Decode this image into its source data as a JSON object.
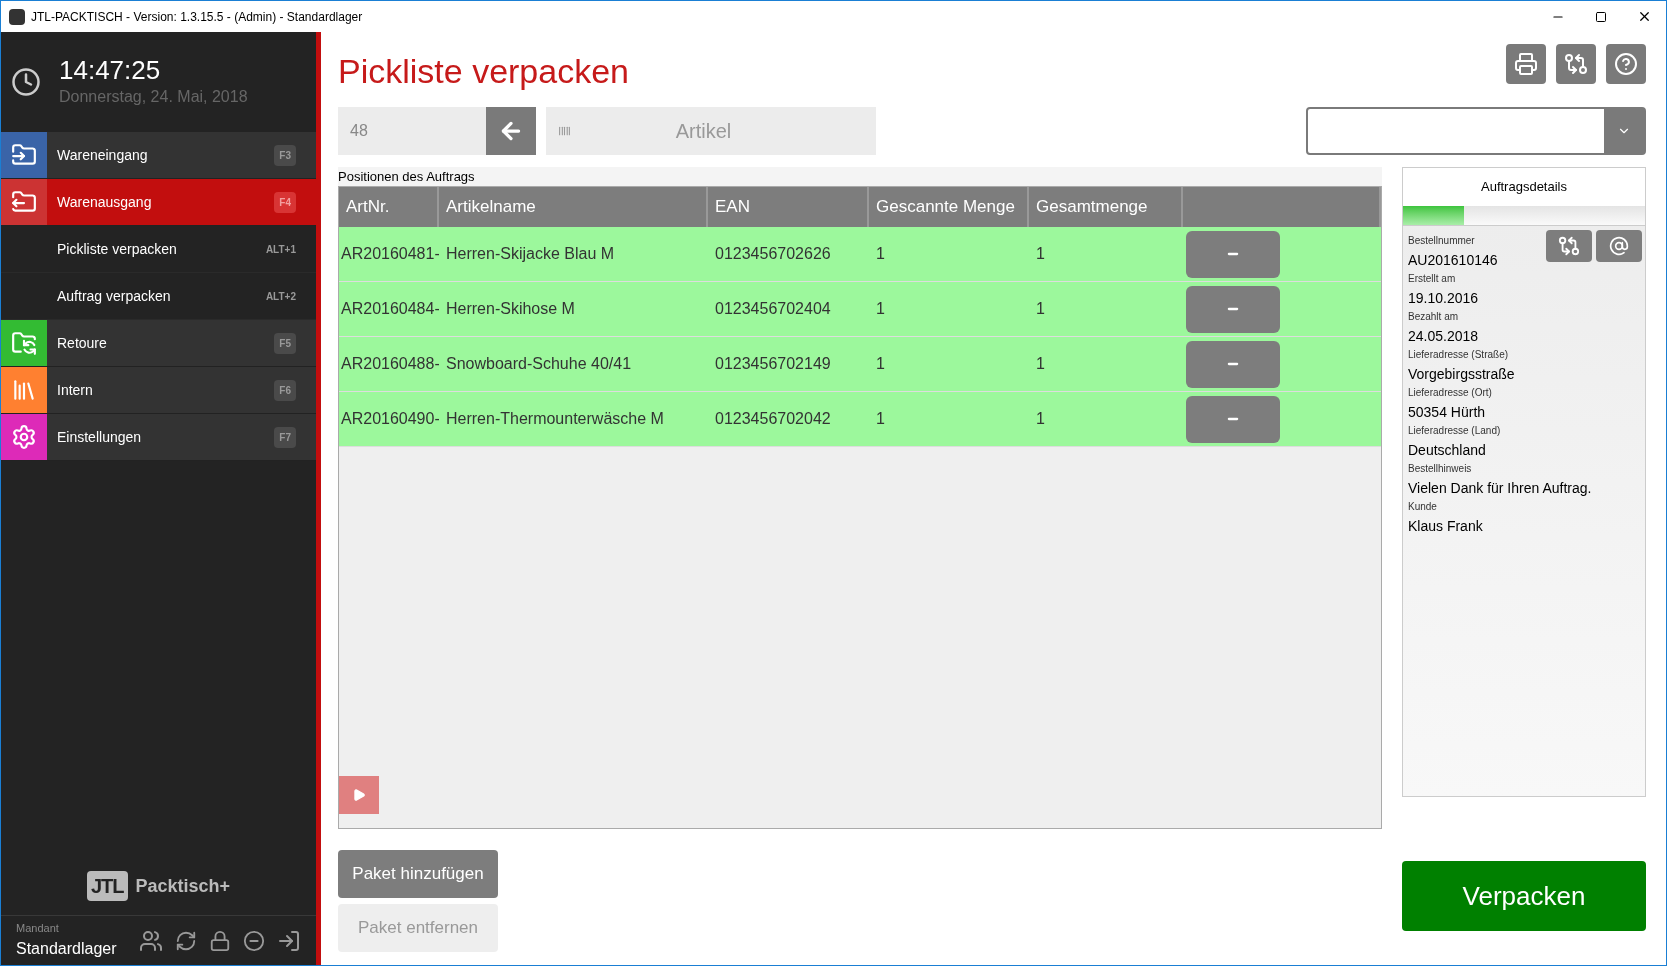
{
  "window": {
    "title": "JTL-PACKTISCH - Version: 1.3.15.5 - (Admin) - Standardlager"
  },
  "clock": {
    "time": "14:47:25",
    "date": "Donnerstag, 24. Mai, 2018"
  },
  "nav": [
    {
      "kind": "section",
      "label": "Wareneingang",
      "shortcut": "F3",
      "color": "#3a64a8",
      "selected": false
    },
    {
      "kind": "section",
      "label": "Warenausgang",
      "shortcut": "F4",
      "color": "#cc3333",
      "selected": true
    },
    {
      "kind": "sub",
      "label": "Pickliste verpacken",
      "shortcut": "ALT+1",
      "selected": false
    },
    {
      "kind": "sub",
      "label": "Auftrag verpacken",
      "shortcut": "ALT+2",
      "selected": false
    },
    {
      "kind": "section",
      "label": "Retoure",
      "shortcut": "F5",
      "color": "#33bb33",
      "selected": false
    },
    {
      "kind": "section",
      "label": "Intern",
      "shortcut": "F6",
      "color": "#ff8030",
      "selected": false
    },
    {
      "kind": "section",
      "label": "Einstellungen",
      "shortcut": "F7",
      "color": "#dd2ab8",
      "selected": false
    }
  ],
  "logo": {
    "mark": "JTL",
    "name": "Packtisch+"
  },
  "mandant": {
    "label": "Mandant",
    "value": "Standardlager"
  },
  "page_title": "Pickliste verpacken",
  "scan": {
    "value": "48",
    "placeholder": "Artikel"
  },
  "table": {
    "caption": "Positionen des Auftrags",
    "columns": [
      "ArtNr.",
      "Artikelname",
      "EAN",
      "Gescannte Menge",
      "Gesamtmenge"
    ],
    "rows": [
      {
        "cells": [
          "AR20160481-",
          "Herren-Skijacke Blau M",
          "0123456702626",
          "1",
          "1"
        ],
        "complete": true
      },
      {
        "cells": [
          "AR20160484-",
          "Herren-Skihose M",
          "0123456702404",
          "1",
          "1"
        ],
        "complete": true
      },
      {
        "cells": [
          "AR20160488-",
          "Snowboard-Schuhe 40/41",
          "0123456702149",
          "1",
          "1"
        ],
        "complete": true
      },
      {
        "cells": [
          "AR20160490-",
          "Herren-Thermounterwäsche M",
          "0123456702042",
          "1",
          "1"
        ],
        "complete": true
      }
    ]
  },
  "details": {
    "title": "Auftragsdetails",
    "level": 0.25,
    "fields": [
      {
        "label": "Bestellnummer",
        "value": "AU201610146"
      },
      {
        "label": "Erstellt am",
        "value": "19.10.2016"
      },
      {
        "label": "Bezahlt am",
        "value": "24.05.2018"
      },
      {
        "label": "Lieferadresse (Straße)",
        "value": "Vorgebirgsstraße"
      },
      {
        "label": "Lieferadresse (Ort)",
        "value": "50354 Hürth"
      },
      {
        "label": "Lieferadresse (Land)",
        "value": "Deutschland"
      },
      {
        "label": "Bestellhinweis",
        "value": "Vielen Dank für Ihren Auftrag."
      },
      {
        "label": "Kunde",
        "value": "Klaus Frank"
      }
    ]
  },
  "buttons": [
    {
      "label": "Paket hinzufügen",
      "disabled": false
    },
    {
      "label": "Paket entfernen",
      "disabled": true
    }
  ],
  "primary_button": "Verpacken"
}
